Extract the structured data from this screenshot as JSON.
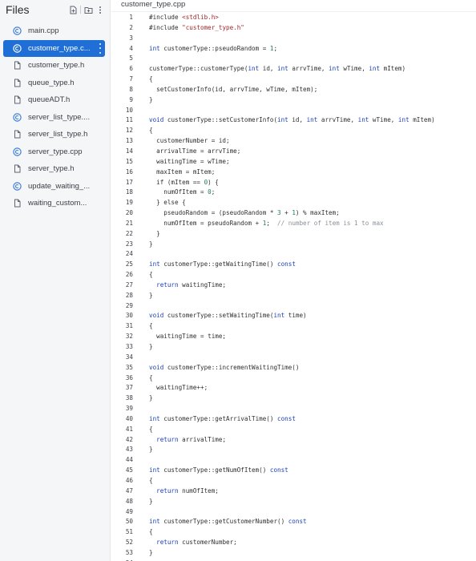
{
  "sidebar": {
    "title": "Files",
    "files": [
      {
        "label": "main.cpp",
        "type": "cpp",
        "active": false
      },
      {
        "label": "customer_type.c...",
        "type": "cpp",
        "active": true
      },
      {
        "label": "customer_type.h",
        "type": "h",
        "active": false
      },
      {
        "label": "queue_type.h",
        "type": "h",
        "active": false
      },
      {
        "label": "queueADT.h",
        "type": "h",
        "active": false
      },
      {
        "label": "server_list_type....",
        "type": "cpp",
        "active": false
      },
      {
        "label": "server_list_type.h",
        "type": "h",
        "active": false
      },
      {
        "label": "server_type.cpp",
        "type": "cpp",
        "active": false
      },
      {
        "label": "server_type.h",
        "type": "h",
        "active": false
      },
      {
        "label": "update_waiting_...",
        "type": "cpp",
        "active": false
      },
      {
        "label": "waiting_custom...",
        "type": "h",
        "active": false
      }
    ]
  },
  "editor": {
    "tab_label": "customer_type.cpp",
    "lines": [
      [
        [
          "#include ",
          "pl"
        ],
        [
          "<stdlib.h>",
          "str"
        ]
      ],
      [
        [
          "#include ",
          "pl"
        ],
        [
          "\"customer_type.h\"",
          "str"
        ]
      ],
      [],
      [
        [
          "int",
          "kw"
        ],
        [
          " customerType::pseudoRandom = ",
          "pl"
        ],
        [
          "1",
          "num"
        ],
        [
          ";",
          "pl"
        ]
      ],
      [],
      [
        [
          "customerType::customerType(",
          "pl"
        ],
        [
          "int",
          "kw"
        ],
        [
          " id, ",
          "pl"
        ],
        [
          "int",
          "kw"
        ],
        [
          " arrvTime, ",
          "pl"
        ],
        [
          "int",
          "kw"
        ],
        [
          " wTime, ",
          "pl"
        ],
        [
          "int",
          "kw"
        ],
        [
          " mItem)",
          "pl"
        ]
      ],
      [
        [
          "{",
          "pl"
        ]
      ],
      [
        [
          "  setCustomerInfo(id, arrvTime, wTime, mItem);",
          "pl"
        ]
      ],
      [
        [
          "}",
          "pl"
        ]
      ],
      [],
      [
        [
          "void",
          "kw"
        ],
        [
          " customerType::setCustomerInfo(",
          "pl"
        ],
        [
          "int",
          "kw"
        ],
        [
          " id, ",
          "pl"
        ],
        [
          "int",
          "kw"
        ],
        [
          " arrvTime, ",
          "pl"
        ],
        [
          "int",
          "kw"
        ],
        [
          " wTime, ",
          "pl"
        ],
        [
          "int",
          "kw"
        ],
        [
          " mItem)",
          "pl"
        ]
      ],
      [
        [
          "{",
          "pl"
        ]
      ],
      [
        [
          "  customerNumber = id;",
          "pl"
        ]
      ],
      [
        [
          "  arrivalTime = arrvTime;",
          "pl"
        ]
      ],
      [
        [
          "  waitingTime = wTime;",
          "pl"
        ]
      ],
      [
        [
          "  maxItem = mItem;",
          "pl"
        ]
      ],
      [
        [
          "  if (mItem == ",
          "pl"
        ],
        [
          "0",
          "num"
        ],
        [
          ") {",
          "pl"
        ]
      ],
      [
        [
          "    numOfItem = ",
          "pl"
        ],
        [
          "0",
          "num"
        ],
        [
          ";",
          "pl"
        ]
      ],
      [
        [
          "  } else {",
          "pl"
        ]
      ],
      [
        [
          "    pseudoRandom = (pseudoRandom * ",
          "pl"
        ],
        [
          "3",
          "num"
        ],
        [
          " + ",
          "pl"
        ],
        [
          "1",
          "num"
        ],
        [
          ") % maxItem;",
          "pl"
        ]
      ],
      [
        [
          "    numOfItem = pseudoRandom + ",
          "pl"
        ],
        [
          "1",
          "num"
        ],
        [
          ";  ",
          "pl"
        ],
        [
          "// number of item is 1 to max",
          "cm"
        ]
      ],
      [
        [
          "  }",
          "pl"
        ]
      ],
      [
        [
          "}",
          "pl"
        ]
      ],
      [],
      [
        [
          "int",
          "kw"
        ],
        [
          " customerType::getWaitingTime() ",
          "pl"
        ],
        [
          "const",
          "kw"
        ]
      ],
      [
        [
          "{",
          "pl"
        ]
      ],
      [
        [
          "  return",
          "kw"
        ],
        [
          " waitingTime;",
          "pl"
        ]
      ],
      [
        [
          "}",
          "pl"
        ]
      ],
      [],
      [
        [
          "void",
          "kw"
        ],
        [
          " customerType::setWaitingTime(",
          "pl"
        ],
        [
          "int",
          "kw"
        ],
        [
          " time)",
          "pl"
        ]
      ],
      [
        [
          "{",
          "pl"
        ]
      ],
      [
        [
          "  waitingTime = time;",
          "pl"
        ]
      ],
      [
        [
          "}",
          "pl"
        ]
      ],
      [],
      [
        [
          "void",
          "kw"
        ],
        [
          " customerType::incrementWaitingTime()",
          "pl"
        ]
      ],
      [
        [
          "{",
          "pl"
        ]
      ],
      [
        [
          "  waitingTime++;",
          "pl"
        ]
      ],
      [
        [
          "}",
          "pl"
        ]
      ],
      [],
      [
        [
          "int",
          "kw"
        ],
        [
          " customerType::getArrivalTime() ",
          "pl"
        ],
        [
          "const",
          "kw"
        ]
      ],
      [
        [
          "{",
          "pl"
        ]
      ],
      [
        [
          "  return",
          "kw"
        ],
        [
          " arrivalTime;",
          "pl"
        ]
      ],
      [
        [
          "}",
          "pl"
        ]
      ],
      [],
      [
        [
          "int",
          "kw"
        ],
        [
          " customerType::getNumOfItem() ",
          "pl"
        ],
        [
          "const",
          "kw"
        ]
      ],
      [
        [
          "{",
          "pl"
        ]
      ],
      [
        [
          "  return",
          "kw"
        ],
        [
          " numOfItem;",
          "pl"
        ]
      ],
      [
        [
          "}",
          "pl"
        ]
      ],
      [],
      [
        [
          "int",
          "kw"
        ],
        [
          " customerType::getCustomerNumber() ",
          "pl"
        ],
        [
          "const",
          "kw"
        ]
      ],
      [
        [
          "{",
          "pl"
        ]
      ],
      [
        [
          "  return",
          "kw"
        ],
        [
          " customerNumber;",
          "pl"
        ]
      ],
      [
        [
          "}",
          "pl"
        ]
      ],
      []
    ]
  }
}
